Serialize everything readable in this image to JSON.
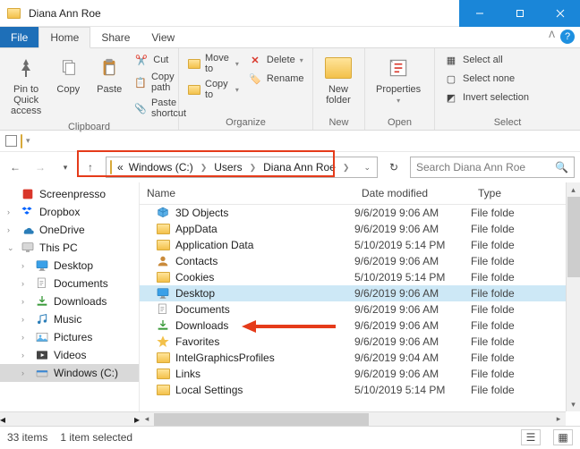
{
  "window": {
    "title": "Diana Ann Roe"
  },
  "menu": {
    "file": "File",
    "home": "Home",
    "share": "Share",
    "view": "View"
  },
  "ribbon": {
    "clipboard": {
      "pin": "Pin to Quick\naccess",
      "copy": "Copy",
      "paste": "Paste",
      "cut": "Cut",
      "copypath": "Copy path",
      "pasteshortcut": "Paste shortcut",
      "label": "Clipboard"
    },
    "organize": {
      "moveto": "Move to",
      "copyto": "Copy to",
      "delete": "Delete",
      "rename": "Rename",
      "label": "Organize"
    },
    "new": {
      "newfolder": "New\nfolder",
      "label": "New"
    },
    "open": {
      "properties": "Properties",
      "label": "Open"
    },
    "select": {
      "selectall": "Select all",
      "selectnone": "Select none",
      "invert": "Invert selection",
      "label": "Select"
    }
  },
  "address": {
    "prefix": "«",
    "crumbs": [
      "Windows (C:)",
      "Users",
      "Diana Ann Roe"
    ]
  },
  "search": {
    "placeholder": "Search Diana Ann Roe"
  },
  "columns": {
    "name": "Name",
    "date": "Date modified",
    "type": "Type"
  },
  "tree": [
    {
      "label": "Screenpresso",
      "icon": "app",
      "indent": 0
    },
    {
      "label": "Dropbox",
      "icon": "dropbox",
      "indent": 0,
      "exp": ">"
    },
    {
      "label": "OneDrive",
      "icon": "onedrive",
      "indent": 0,
      "exp": ">"
    },
    {
      "label": "This PC",
      "icon": "thispc",
      "indent": 0,
      "exp": "v"
    },
    {
      "label": "Desktop",
      "icon": "desktop",
      "indent": 1,
      "exp": ">"
    },
    {
      "label": "Documents",
      "icon": "documents",
      "indent": 1,
      "exp": ">"
    },
    {
      "label": "Downloads",
      "icon": "downloads",
      "indent": 1,
      "exp": ">"
    },
    {
      "label": "Music",
      "icon": "music",
      "indent": 1,
      "exp": ">"
    },
    {
      "label": "Pictures",
      "icon": "pictures",
      "indent": 1,
      "exp": ">"
    },
    {
      "label": "Videos",
      "icon": "videos",
      "indent": 1,
      "exp": ">"
    },
    {
      "label": "Windows (C:)",
      "icon": "drive",
      "indent": 1,
      "exp": ">",
      "selected": true
    }
  ],
  "files": [
    {
      "name": "3D Objects",
      "date": "9/6/2019 9:06 AM",
      "type": "File folde",
      "icon": "3d"
    },
    {
      "name": "AppData",
      "date": "9/6/2019 9:06 AM",
      "type": "File folde",
      "icon": "folder"
    },
    {
      "name": "Application Data",
      "date": "5/10/2019 5:14 PM",
      "type": "File folde",
      "icon": "folder"
    },
    {
      "name": "Contacts",
      "date": "9/6/2019 9:06 AM",
      "type": "File folde",
      "icon": "contacts"
    },
    {
      "name": "Cookies",
      "date": "5/10/2019 5:14 PM",
      "type": "File folde",
      "icon": "folder"
    },
    {
      "name": "Desktop",
      "date": "9/6/2019 9:06 AM",
      "type": "File folde",
      "icon": "desktop",
      "selected": true
    },
    {
      "name": "Documents",
      "date": "9/6/2019 9:06 AM",
      "type": "File folde",
      "icon": "documents"
    },
    {
      "name": "Downloads",
      "date": "9/6/2019 9:06 AM",
      "type": "File folde",
      "icon": "downloads"
    },
    {
      "name": "Favorites",
      "date": "9/6/2019 9:06 AM",
      "type": "File folde",
      "icon": "favorites"
    },
    {
      "name": "IntelGraphicsProfiles",
      "date": "9/6/2019 9:04 AM",
      "type": "File folde",
      "icon": "folder"
    },
    {
      "name": "Links",
      "date": "9/6/2019 9:06 AM",
      "type": "File folde",
      "icon": "folder"
    },
    {
      "name": "Local Settings",
      "date": "5/10/2019 5:14 PM",
      "type": "File folde",
      "icon": "folder"
    }
  ],
  "status": {
    "count": "33 items",
    "selected": "1 item selected"
  }
}
